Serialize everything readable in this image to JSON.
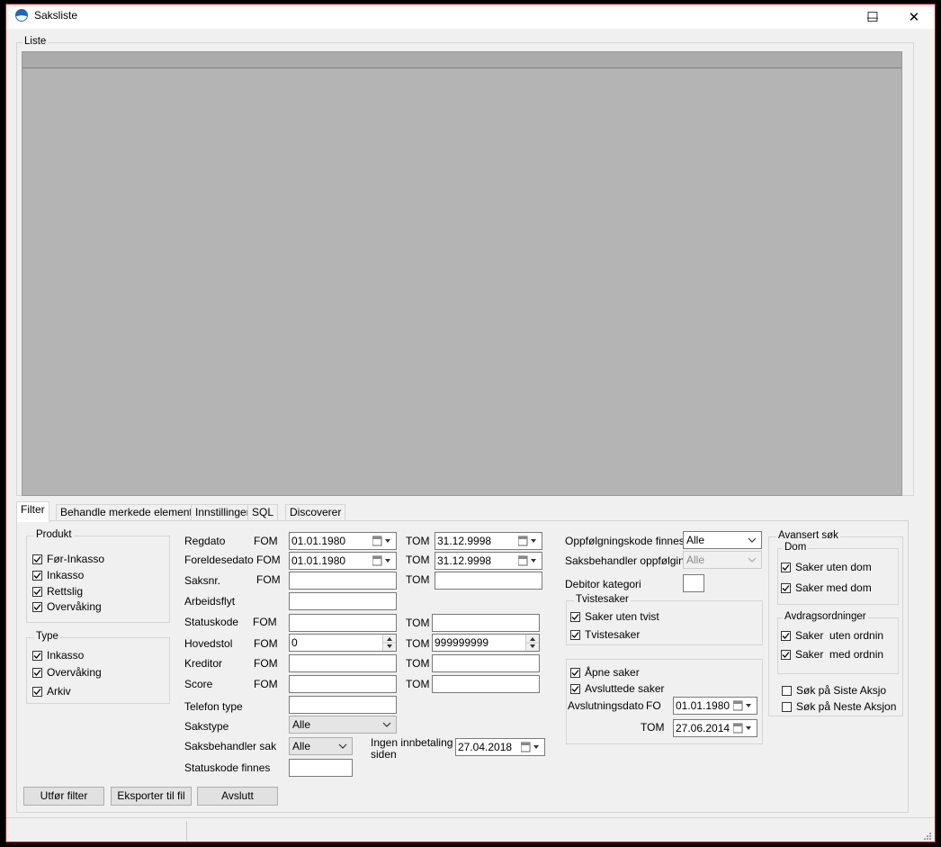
{
  "window": {
    "title": "Saksliste",
    "minimize": "—",
    "maximize": "☐",
    "close": "✕"
  },
  "list_group": {
    "label": "Liste"
  },
  "tabs": [
    {
      "label": "Filter",
      "active": true
    },
    {
      "label": "Behandle merkede elementer"
    },
    {
      "label": "Innstillinger"
    },
    {
      "label": "SQL"
    },
    {
      "label": "Discoverer"
    }
  ],
  "produkt": {
    "label": "Produkt",
    "items": [
      {
        "label": "Før-Inkasso",
        "checked": true
      },
      {
        "label": "Inkasso",
        "checked": true
      },
      {
        "label": "Rettslig",
        "checked": true
      },
      {
        "label": "Overvåking",
        "checked": true
      }
    ]
  },
  "type": {
    "label": "Type",
    "items": [
      {
        "label": "Inkasso",
        "checked": true
      },
      {
        "label": "Overvåking",
        "checked": true
      },
      {
        "label": "Arkiv",
        "checked": true
      }
    ]
  },
  "fields": {
    "fom": "FOM",
    "tom": "TOM",
    "regdato": {
      "label": "Regdato",
      "fom": "01.01.1980",
      "tom": "31.12.9998"
    },
    "foreldesedato": {
      "label": "Foreldesedato",
      "fom": "01.01.1980",
      "tom": "31.12.9998"
    },
    "saksnr": {
      "label": "Saksnr.",
      "fom": "",
      "tom": ""
    },
    "arbeidsflyt": {
      "label": "Arbeidsflyt",
      "value": ""
    },
    "statuskode": {
      "label": "Statuskode",
      "fom": "",
      "tom": ""
    },
    "hovedstol": {
      "label": "Hovedstol",
      "fom": "0",
      "tom": "999999999"
    },
    "kreditor": {
      "label": "Kreditor",
      "fom": "",
      "tom": ""
    },
    "score": {
      "label": "Score",
      "fom": "",
      "tom": ""
    },
    "telefon_type": {
      "label": "Telefon type",
      "value": ""
    },
    "sakstype": {
      "label": "Sakstype",
      "value": "Alle"
    },
    "saksbehandler_sak": {
      "label": "Saksbehandler sak",
      "value": "Alle"
    },
    "ingen_innbetaling": {
      "label_line1": "Ingen innbetaling",
      "label_line2": "siden",
      "value": "27.04.2018"
    },
    "statuskode_finnes": {
      "label": "Statuskode finnes",
      "value": ""
    }
  },
  "right": {
    "oppfolgingskode": {
      "label": "Oppfølgningskode finnes",
      "value": "Alle"
    },
    "saksbehandler_oppfolging": {
      "label": "Saksbehandler oppfølging",
      "value": "Alle"
    },
    "debitor_kategori": {
      "label": "Debitor kategori",
      "value": ""
    },
    "tvistesaker": {
      "label": "Tvistesaker",
      "items": [
        {
          "label": "Saker uten tvist",
          "checked": true
        },
        {
          "label": "Tvistesaker",
          "checked": true
        }
      ]
    },
    "apne_saker": {
      "label": "Åpne saker",
      "checked": true
    },
    "avsluttede_saker": {
      "label": "Avsluttede saker",
      "checked": true
    },
    "avslutningsdato": {
      "label": "Avslutningsdato",
      "fo": "FO",
      "tom_label": "TOM",
      "fom": "01.01.1980",
      "tom": "27.06.2014"
    }
  },
  "avansert": {
    "label": "Avansert søk",
    "dom": {
      "label": "Dom",
      "items": [
        {
          "label": "Saker uten dom",
          "checked": true
        },
        {
          "label": "Saker med dom",
          "checked": true
        }
      ]
    },
    "avdrag": {
      "label": "Avdragsordninger",
      "items": [
        {
          "label": "Saker  uten ordnin",
          "checked": true
        },
        {
          "label": "Saker  med ordnin",
          "checked": true
        }
      ]
    },
    "sok_siste": {
      "label": "Søk på Siste Aksjo",
      "checked": false
    },
    "sok_neste": {
      "label": "Søk på Neste Aksjon",
      "checked": false
    }
  },
  "buttons": {
    "utfor": "Utfør filter",
    "eksporter": "Eksporter til fil",
    "avslutt": "Avslutt"
  },
  "colors": {
    "list_bg": "#b4b4b4",
    "window_border": "#d00000",
    "panel_bg": "#f0f0f0"
  }
}
